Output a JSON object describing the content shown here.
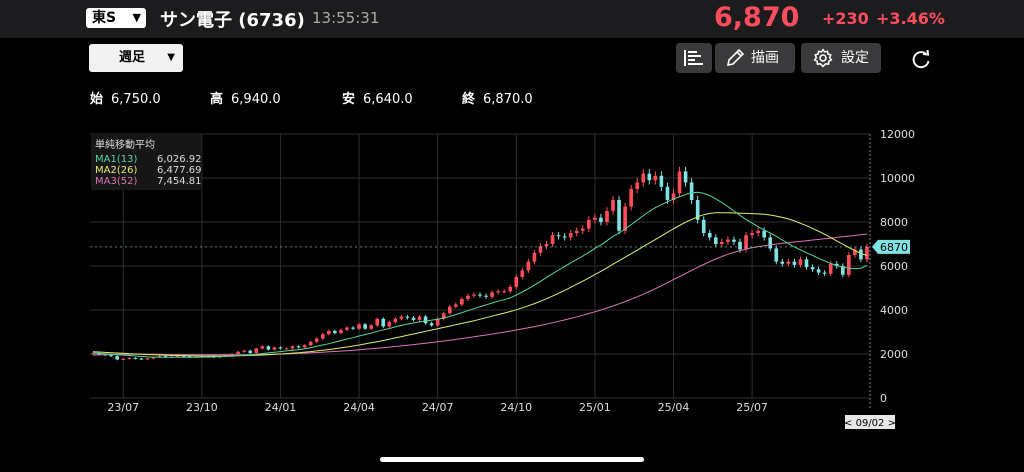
{
  "header": {
    "market": "東S",
    "name": "サン電子",
    "code": "(6736)",
    "time": "13:55:31",
    "price": "6,870",
    "change": "+230",
    "change_pct": "+3.46%"
  },
  "toolbar": {
    "period": "週足",
    "draw_label": "描画",
    "settings_label": "設定"
  },
  "ohlc": {
    "open_label": "始",
    "open": "6,750.0",
    "high_label": "高",
    "high": "6,940.0",
    "low_label": "安",
    "low": "6,640.0",
    "close_label": "終",
    "close": "6,870.0"
  },
  "legend": {
    "title": "単純移動平均",
    "ma1_label": "MA1(13)",
    "ma1_value": "6,026.92",
    "ma2_label": "MA2(26)",
    "ma2_value": "6,477.69",
    "ma3_label": "MA3(52)",
    "ma3_value": "7,454.81"
  },
  "colors": {
    "up": "#ff4d5e",
    "down": "#7fe3e3",
    "ma1": "#4fd6a0",
    "ma2": "#e2ec6a",
    "ma3": "#d874b6",
    "grid": "#2e2e2e"
  },
  "chart_data": {
    "type": "candlestick",
    "ylim": [
      0,
      12000
    ],
    "yticks": [
      0,
      2000,
      4000,
      6000,
      8000,
      10000,
      12000
    ],
    "xticks": [
      "23/07",
      "23/10",
      "24/01",
      "24/04",
      "24/07",
      "24/10",
      "25/01",
      "25/04",
      "25/07"
    ],
    "date_label": "< 09/02 >",
    "last_price_label": "6870",
    "last_price": 6870,
    "closes": [
      2030,
      1980,
      1950,
      1900,
      1750,
      1780,
      1820,
      1790,
      1760,
      1800,
      1850,
      1900,
      1870,
      1880,
      1920,
      1900,
      1860,
      1880,
      1900,
      1920,
      1850,
      1890,
      1950,
      2000,
      2100,
      2150,
      2050,
      2250,
      2350,
      2200,
      2300,
      2250,
      2250,
      2350,
      2300,
      2400,
      2550,
      2700,
      2900,
      3050,
      2950,
      3100,
      3200,
      3150,
      3350,
      3150,
      3300,
      3600,
      3250,
      3450,
      3600,
      3700,
      3650,
      3550,
      3700,
      3400,
      3300,
      3600,
      3850,
      4150,
      4250,
      4500,
      4650,
      4700,
      4650,
      4600,
      4800,
      4850,
      4850,
      5050,
      5500,
      5800,
      6200,
      6600,
      6900,
      7000,
      7400,
      7350,
      7300,
      7500,
      7600,
      7700,
      8100,
      8200,
      8000,
      8500,
      9000,
      7600,
      8700,
      9500,
      9800,
      10200,
      9900,
      10100,
      9600,
      9000,
      9300,
      10300,
      9800,
      9000,
      8100,
      7500,
      7300,
      7000,
      7100,
      7200,
      7100,
      6750,
      7400,
      7500,
      7600,
      7300,
      6800,
      6200,
      6100,
      6200,
      6050,
      6300,
      5950,
      5850,
      5700,
      5650,
      6100,
      6000,
      5600,
      6500,
      6750,
      6300,
      6870
    ],
    "ma1": [
      2050,
      2030,
      2010,
      1990,
      1970,
      1950,
      1930,
      1910,
      1890,
      1870,
      1860,
      1850,
      1850,
      1850,
      1850,
      1850,
      1850,
      1850,
      1860,
      1860,
      1870,
      1880,
      1890,
      1900,
      1920,
      1940,
      1960,
      1990,
      2020,
      2050,
      2080,
      2110,
      2140,
      2170,
      2200,
      2240,
      2290,
      2350,
      2410,
      2470,
      2540,
      2610,
      2680,
      2740,
      2820,
      2880,
      2950,
      3030,
      3100,
      3160,
      3230,
      3300,
      3360,
      3410,
      3460,
      3500,
      3540,
      3580,
      3640,
      3710,
      3790,
      3880,
      3970,
      4060,
      4150,
      4230,
      4320,
      4400,
      4470,
      4550,
      4680,
      4820,
      4970,
      5130,
      5300,
      5480,
      5650,
      5820,
      5980,
      6140,
      6300,
      6450,
      6620,
      6800,
      6960,
      7150,
      7350,
      7500,
      7680,
      7880,
      8080,
      8290,
      8480,
      8650,
      8790,
      8920,
      9040,
      9150,
      9250,
      9330,
      9350,
      9300,
      9200,
      9050,
      8880,
      8700,
      8500,
      8300,
      8120,
      7950,
      7780,
      7630,
      7500,
      7350,
      7180,
      7020,
      6870,
      6730,
      6600,
      6480,
      6350,
      6230,
      6120,
      6020,
      5950,
      5900,
      5880,
      5900,
      6027
    ],
    "ma2": [
      2100,
      2090,
      2075,
      2060,
      2045,
      2030,
      2015,
      2000,
      1985,
      1975,
      1965,
      1955,
      1945,
      1935,
      1930,
      1925,
      1920,
      1915,
      1910,
      1910,
      1910,
      1910,
      1910,
      1915,
      1920,
      1925,
      1935,
      1945,
      1955,
      1970,
      1985,
      2000,
      2020,
      2040,
      2060,
      2085,
      2110,
      2140,
      2170,
      2200,
      2240,
      2280,
      2320,
      2365,
      2410,
      2460,
      2510,
      2560,
      2615,
      2670,
      2730,
      2790,
      2850,
      2910,
      2970,
      3030,
      3090,
      3150,
      3210,
      3270,
      3330,
      3390,
      3450,
      3510,
      3580,
      3650,
      3720,
      3790,
      3860,
      3930,
      4010,
      4100,
      4190,
      4290,
      4400,
      4510,
      4630,
      4760,
      4890,
      5030,
      5170,
      5310,
      5460,
      5610,
      5760,
      5920,
      6080,
      6240,
      6400,
      6560,
      6720,
      6880,
      7040,
      7200,
      7370,
      7530,
      7690,
      7840,
      7990,
      8120,
      8240,
      8330,
      8390,
      8420,
      8420,
      8420,
      8410,
      8400,
      8390,
      8380,
      8370,
      8350,
      8320,
      8270,
      8210,
      8140,
      8050,
      7940,
      7830,
      7710,
      7580,
      7440,
      7290,
      7140,
      6990,
      6840,
      6700,
      6570,
      6478
    ],
    "ma3": [
      1950,
      1960,
      1970,
      1975,
      1980,
      1985,
      1985,
      1985,
      1985,
      1985,
      1985,
      1980,
      1978,
      1975,
      1973,
      1970,
      1968,
      1966,
      1965,
      1964,
      1963,
      1962,
      1962,
      1962,
      1963,
      1965,
      1968,
      1972,
      1977,
      1983,
      1990,
      1998,
      2007,
      2017,
      2028,
      2040,
      2053,
      2067,
      2082,
      2098,
      2115,
      2133,
      2152,
      2172,
      2193,
      2215,
      2238,
      2262,
      2287,
      2313,
      2340,
      2368,
      2397,
      2427,
      2458,
      2490,
      2523,
      2557,
      2592,
      2628,
      2665,
      2703,
      2742,
      2782,
      2823,
      2865,
      2908,
      2952,
      2997,
      3043,
      3090,
      3140,
      3190,
      3245,
      3300,
      3360,
      3420,
      3485,
      3550,
      3620,
      3690,
      3765,
      3840,
      3920,
      4000,
      4090,
      4180,
      4280,
      4380,
      4490,
      4600,
      4720,
      4840,
      4970,
      5100,
      5240,
      5380,
      5520,
      5660,
      5800,
      5940,
      6070,
      6200,
      6320,
      6430,
      6530,
      6620,
      6700,
      6770,
      6830,
      6880,
      6920,
      6960,
      7000,
      7030,
      7060,
      7090,
      7120,
      7150,
      7180,
      7210,
      7240,
      7270,
      7300,
      7330,
      7360,
      7390,
      7420,
      7455
    ]
  }
}
